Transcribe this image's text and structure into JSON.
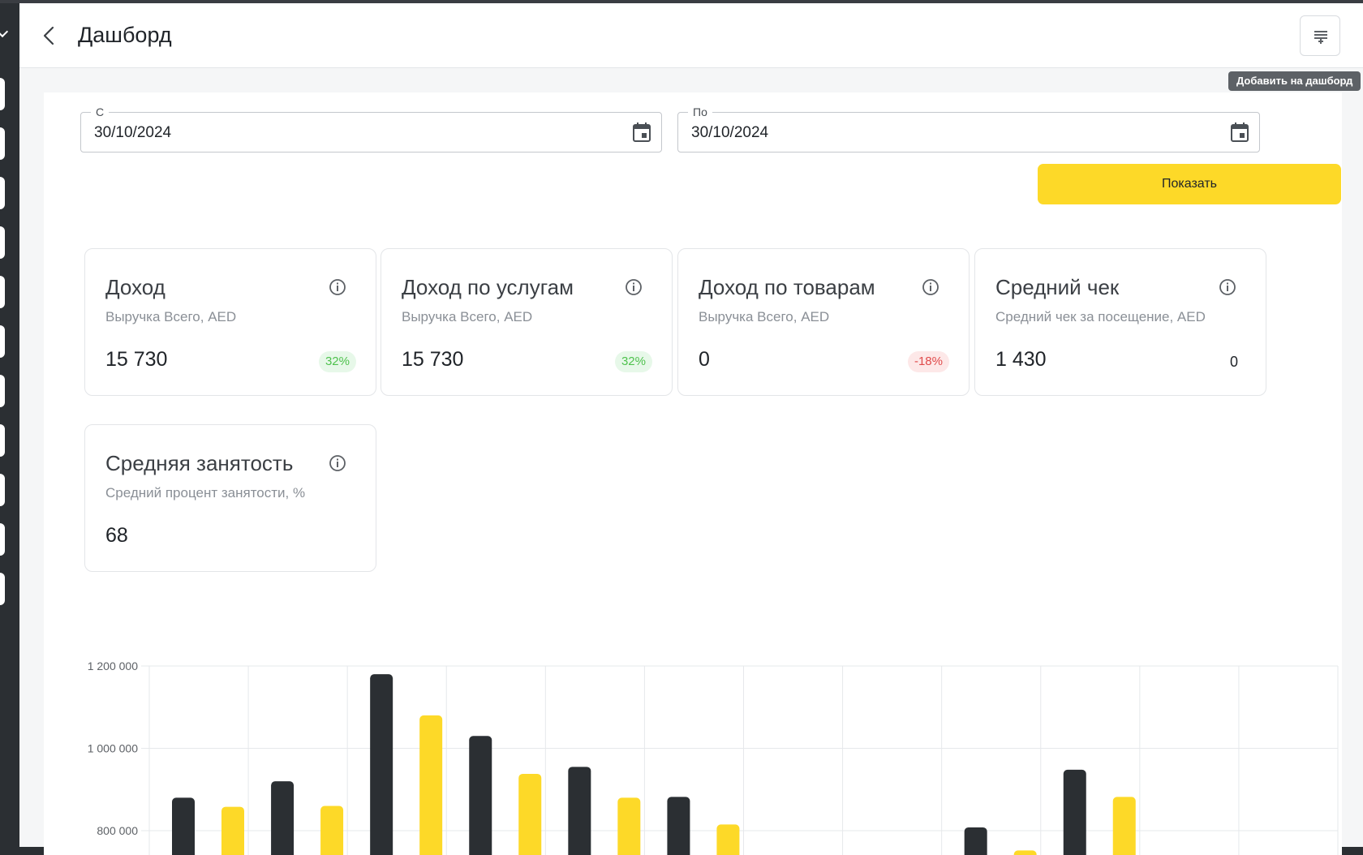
{
  "header": {
    "title": "Дашборд",
    "add_tooltip": "Добавить на дашборд"
  },
  "filters": {
    "from_label": "С",
    "from_value": "30/10/2024",
    "to_label": "По",
    "to_value": "30/10/2024",
    "show_label": "Показать"
  },
  "cards": [
    {
      "title": "Доход",
      "subtitle": "Выручка Всего, AED",
      "value": "15 730",
      "badge": "32%",
      "badge_type": "pos"
    },
    {
      "title": "Доход по услугам",
      "subtitle": "Выручка Всего, AED",
      "value": "15 730",
      "badge": "32%",
      "badge_type": "pos"
    },
    {
      "title": "Доход по товарам",
      "subtitle": "Выручка Всего, AED",
      "value": "0",
      "badge": "-18%",
      "badge_type": "neg"
    },
    {
      "title": "Средний чек",
      "subtitle": "Средний чек за посещение, AED",
      "value": "1 430",
      "badge": "0",
      "badge_type": "plain"
    },
    {
      "title": "Средняя занятость",
      "subtitle": "Средний процент занятости, %",
      "value": "68",
      "badge": "",
      "badge_type": "none"
    }
  ],
  "colors": {
    "accent": "#fdd928",
    "dark_series": "#2b2f33",
    "positive": "#4fc24e",
    "negative": "#e04b4b"
  },
  "chart_data": {
    "type": "bar",
    "ytick_labels": [
      "800 000",
      "1 000 000",
      "1 200 000"
    ],
    "yticks": [
      800000,
      1000000,
      1200000
    ],
    "ylim_visible": [
      660000,
      1200000
    ],
    "grid": true,
    "series": [
      {
        "values": [
          880000,
          920000,
          1180000,
          1030000,
          955000,
          882000,
          null,
          null,
          808000,
          948000,
          null,
          null
        ],
        "color": "#2b2f33"
      },
      {
        "values": [
          858000,
          860000,
          1080000,
          938000,
          880000,
          815000,
          null,
          null,
          752000,
          882000,
          null,
          null
        ],
        "color": "#fdd928"
      }
    ]
  }
}
